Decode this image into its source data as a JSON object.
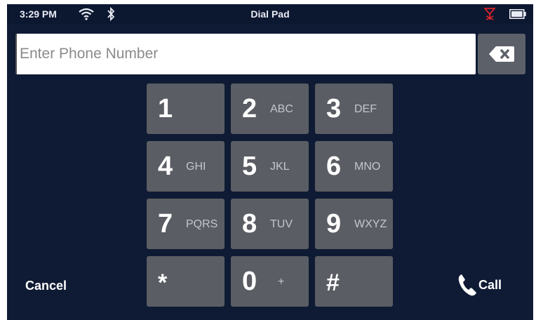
{
  "status_bar": {
    "time": "3:29 PM",
    "title": "Dial Pad",
    "icons": [
      "wifi-icon",
      "bluetooth-icon",
      "no-signal-icon",
      "battery-icon"
    ],
    "signal_color": "#d8232a"
  },
  "entry": {
    "placeholder": "Enter Phone Number",
    "value": "",
    "backspace_icon": "backspace-icon"
  },
  "keypad": {
    "keys": [
      {
        "digit": "1",
        "letters": ""
      },
      {
        "digit": "2",
        "letters": "ABC"
      },
      {
        "digit": "3",
        "letters": "DEF"
      },
      {
        "digit": "4",
        "letters": "GHI"
      },
      {
        "digit": "5",
        "letters": "JKL"
      },
      {
        "digit": "6",
        "letters": "MNO"
      },
      {
        "digit": "7",
        "letters": "PQRS"
      },
      {
        "digit": "8",
        "letters": "TUV"
      },
      {
        "digit": "9",
        "letters": "WXYZ"
      },
      {
        "digit": "*",
        "letters": ""
      },
      {
        "digit": "0",
        "letters": "+"
      },
      {
        "digit": "#",
        "letters": ""
      }
    ]
  },
  "actions": {
    "cancel_label": "Cancel",
    "call_label": "Call",
    "call_icon": "phone-icon"
  },
  "colors": {
    "background": "#0f1b34",
    "key": "#5a5d63",
    "text": "#ffffff"
  }
}
